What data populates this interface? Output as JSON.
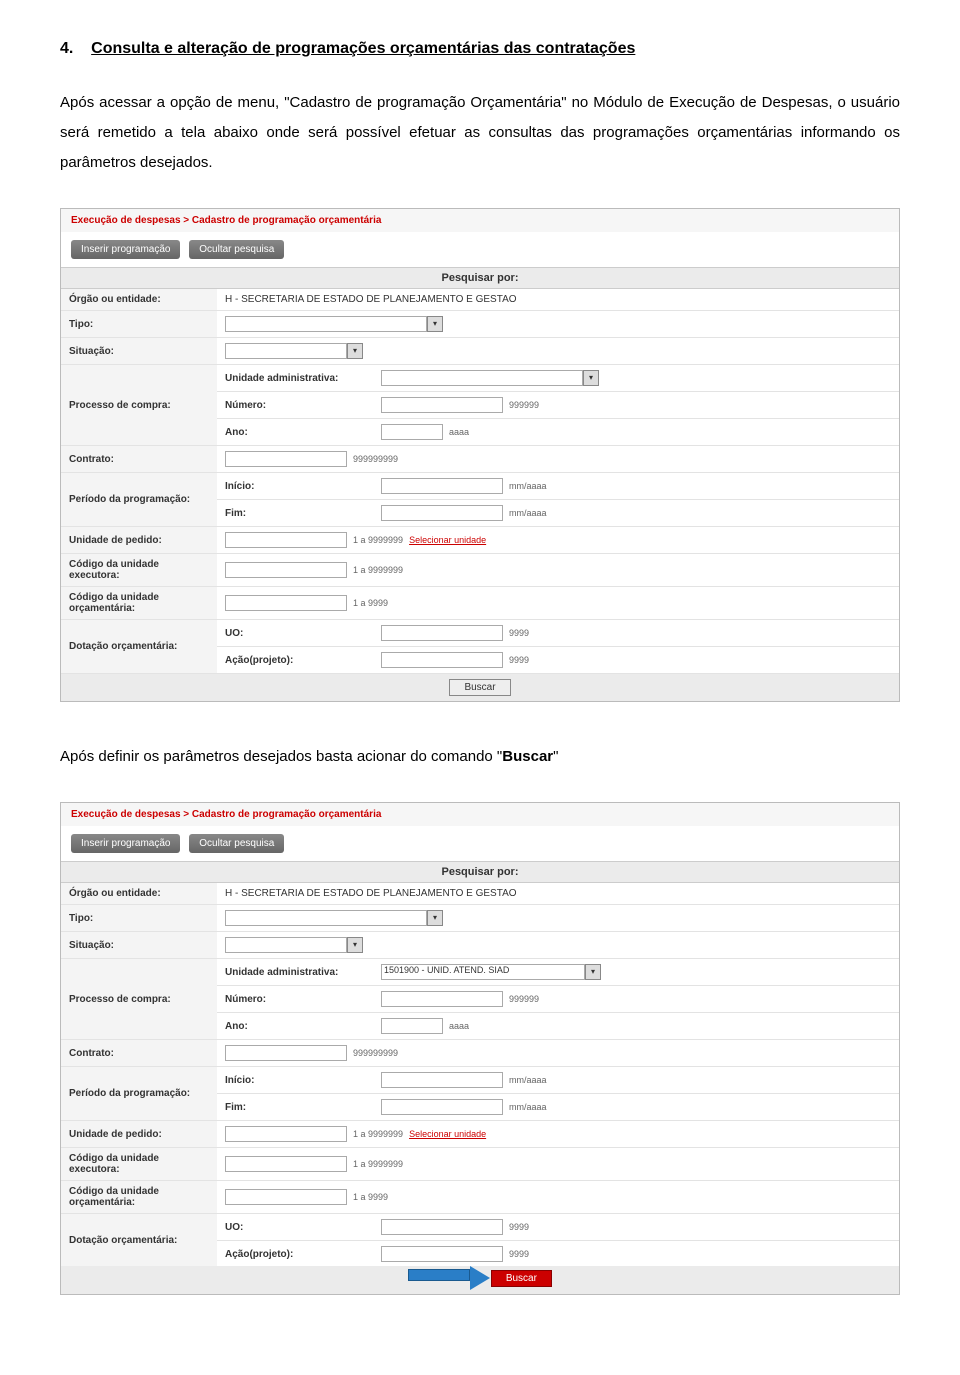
{
  "heading": {
    "number": "4.",
    "title": "Consulta e alteração de programações orçamentárias das contratações"
  },
  "paragraph1": {
    "prefix": "Após acessar a opção de menu, \"",
    "menuItem": "Cadastro de programação Orçamentária",
    "suffix": "\" no Módulo de Execução de Despesas, o usuário será remetido a tela abaixo onde será possível efetuar as consultas das programações orçamentárias informando os parâmetros desejados."
  },
  "paragraph2": {
    "text_prefix": "Após definir os parâmetros desejados basta acionar do comando \"",
    "bold_word": "Buscar",
    "text_suffix": "\""
  },
  "form": {
    "breadcrumb": "Execução de despesas > Cadastro de programação orçamentária",
    "btn_inserir": "Inserir programação",
    "btn_ocultar": "Ocultar pesquisa",
    "search_header": "Pesquisar por:",
    "labels": {
      "orgao": "Órgão ou entidade:",
      "orgao_value": "H - SECRETARIA DE ESTADO DE PLANEJAMENTO E GESTAO",
      "tipo": "Tipo:",
      "situacao": "Situação:",
      "processo": "Processo de compra:",
      "unidade_admin": "Unidade administrativa:",
      "unidade_admin_value2": "1501900 - UNID. ATEND. SIAD",
      "numero": "Número:",
      "hint_numero": "999999",
      "ano": "Ano:",
      "hint_ano": "aaaa",
      "contrato": "Contrato:",
      "hint_contrato": "999999999",
      "periodo": "Período da programação:",
      "inicio": "Início:",
      "hint_inicio": "mm/aaaa",
      "fim": "Fim:",
      "hint_fim": "mm/aaaa",
      "unidade_pedido": "Unidade de pedido:",
      "hint_pedido": "1 a 9999999",
      "sel_unidade": "Selecionar unidade",
      "cod_exec": "Código da unidade executora:",
      "hint_exec": "1 a 9999999",
      "cod_orc": "Código da unidade orçamentária:",
      "hint_orc": "1 a 9999",
      "dotacao": "Dotação orçamentária:",
      "uo": "UO:",
      "hint_uo": "9999",
      "acao": "Ação(projeto):",
      "hint_acao": "9999",
      "buscar": "Buscar"
    }
  }
}
